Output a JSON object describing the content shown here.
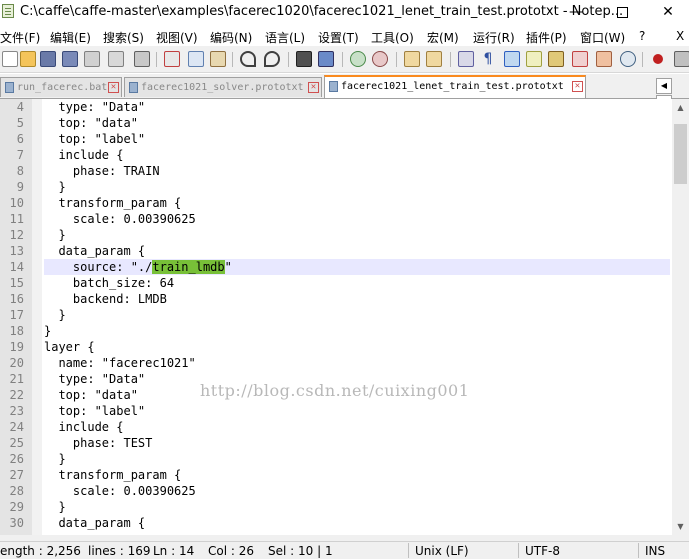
{
  "window": {
    "title": "C:\\caffe\\caffe-master\\examples\\facerec1020\\facerec1021_lenet_train_test.prototxt - Notep...",
    "minimize": "—",
    "maximize": "",
    "close": "✕"
  },
  "menu": [
    "文件(F)",
    "编辑(E)",
    "搜索(S)",
    "视图(V)",
    "编码(N)",
    "语言(L)",
    "设置(T)",
    "工具(O)",
    "宏(M)",
    "运行(R)",
    "插件(P)",
    "窗口(W)",
    "?",
    "X"
  ],
  "tabs": [
    {
      "label": "run_facerec.bat",
      "close": "✕"
    },
    {
      "label": "facerec1021_solver.prototxt",
      "close": "✕"
    },
    {
      "label": "facerec1021_lenet_train_test.prototxt",
      "close": "✕"
    }
  ],
  "tab_arrows": [
    "◀",
    "▶"
  ],
  "editor": {
    "lines": [
      {
        "num": "4",
        "text": "  type: \"Data\""
      },
      {
        "num": "5",
        "text": "  top: \"data\""
      },
      {
        "num": "6",
        "text": "  top: \"label\""
      },
      {
        "num": "7",
        "text": "  include {"
      },
      {
        "num": "8",
        "text": "    phase: TRAIN"
      },
      {
        "num": "9",
        "text": "  }"
      },
      {
        "num": "10",
        "text": "  transform_param {"
      },
      {
        "num": "11",
        "text": "    scale: 0.00390625"
      },
      {
        "num": "12",
        "text": "  }"
      },
      {
        "num": "13",
        "text": "  data_param {"
      },
      {
        "num": "14",
        "pre": "    source: \"./",
        "hl": "train_lmdb",
        "post": "\""
      },
      {
        "num": "15",
        "text": "    batch_size: 64"
      },
      {
        "num": "16",
        "text": "    backend: LMDB"
      },
      {
        "num": "17",
        "text": "  }"
      },
      {
        "num": "18",
        "text": "}"
      },
      {
        "num": "19",
        "text": "layer {"
      },
      {
        "num": "20",
        "text": "  name: \"facerec1021\""
      },
      {
        "num": "21",
        "text": "  type: \"Data\""
      },
      {
        "num": "22",
        "text": "  top: \"data\""
      },
      {
        "num": "23",
        "text": "  top: \"label\""
      },
      {
        "num": "24",
        "text": "  include {"
      },
      {
        "num": "25",
        "text": "    phase: TEST"
      },
      {
        "num": "26",
        "text": "  }"
      },
      {
        "num": "27",
        "text": "  transform_param {"
      },
      {
        "num": "28",
        "text": "    scale: 0.00390625"
      },
      {
        "num": "29",
        "text": "  }"
      },
      {
        "num": "30",
        "text": "  data_param {"
      }
    ],
    "watermark": "http://blog.csdn.net/cuixing001"
  },
  "scrollbar": {
    "up": "▲",
    "down": "▼"
  },
  "status": {
    "length": "ength : 2,256",
    "lines": "lines : 169",
    "ln": "Ln : 14",
    "col": "Col : 26",
    "sel": "Sel : 10 | 1",
    "eol": "Unix (LF)",
    "encoding": "UTF-8",
    "mode": "INS"
  },
  "colors": {
    "highlight": "#78c038",
    "current_line": "#e8e8ff",
    "active_tab_accent": "#fa8a1e"
  }
}
